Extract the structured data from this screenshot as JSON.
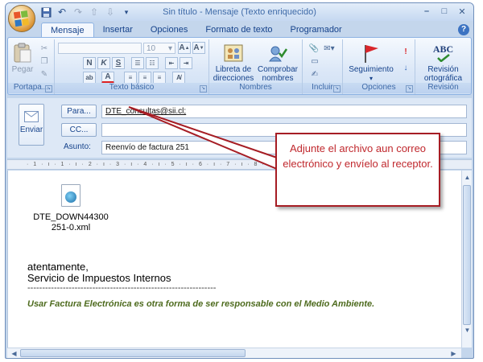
{
  "window": {
    "title": "Sin título - Mensaje (Texto enriquecido)",
    "controls": {
      "minimize": "–",
      "maximize": "□",
      "close": "✕"
    }
  },
  "quick_access": [
    "save-icon",
    "undo-icon",
    "redo-icon",
    "up-arrow-icon",
    "down-arrow-icon",
    "customize-icon"
  ],
  "tabs": [
    {
      "label": "Mensaje",
      "active": true
    },
    {
      "label": "Insertar",
      "active": false
    },
    {
      "label": "Opciones",
      "active": false
    },
    {
      "label": "Formato de texto",
      "active": false
    },
    {
      "label": "Programador",
      "active": false
    }
  ],
  "ribbon": {
    "groups": {
      "clipboard": {
        "label": "Portapa...",
        "paste": "Pegar"
      },
      "basic_text": {
        "label": "Texto básico",
        "font_size": "10",
        "bold": "N",
        "italic": "K",
        "underline": "S"
      },
      "names": {
        "label": "Nombres",
        "address_book": "Libreta de direcciones",
        "check_names": "Comprobar nombres"
      },
      "include": {
        "label": "Incluir"
      },
      "options": {
        "label": "Opciones",
        "follow_up": "Seguimiento"
      },
      "review": {
        "label": "Revisión",
        "spelling": "Revisión ortográfica",
        "abc": "ABC"
      }
    }
  },
  "header": {
    "send": "Enviar",
    "to_button": "Para...",
    "cc_button": "CC...",
    "subject_label": "Asunto:",
    "to_value": "DTE_consultas@sii.cl;",
    "cc_value": "",
    "subject_value": "Reenvío de factura 251"
  },
  "ruler": "· 1 · ı · 1 · ı · 2 · ı · 3 · ı · 4 · ı · 5 · ı · 6 · ı · 7 · ı · 8 · ı · 9 · ı · 10 · ı · 11 · ı · 12 · ı · 13",
  "body": {
    "attachment_name_1": "DTE_DOWN44300",
    "attachment_name_2": "251-0.xml",
    "greeting": "atentamente,",
    "signature": "Servicio de Impuestos Internos",
    "separator": "----------------------------------------------------------------",
    "footer": "Usar Factura Electrónica es otra forma de ser responsable con el Medio Ambiente."
  },
  "callout": {
    "text": "Adjunte el archivo aun correo electrónico y envíelo al receptor.",
    "color": "#c0282d"
  },
  "colors": {
    "ribbon_text": "#15428b",
    "footer_green": "#4e6b1e"
  }
}
